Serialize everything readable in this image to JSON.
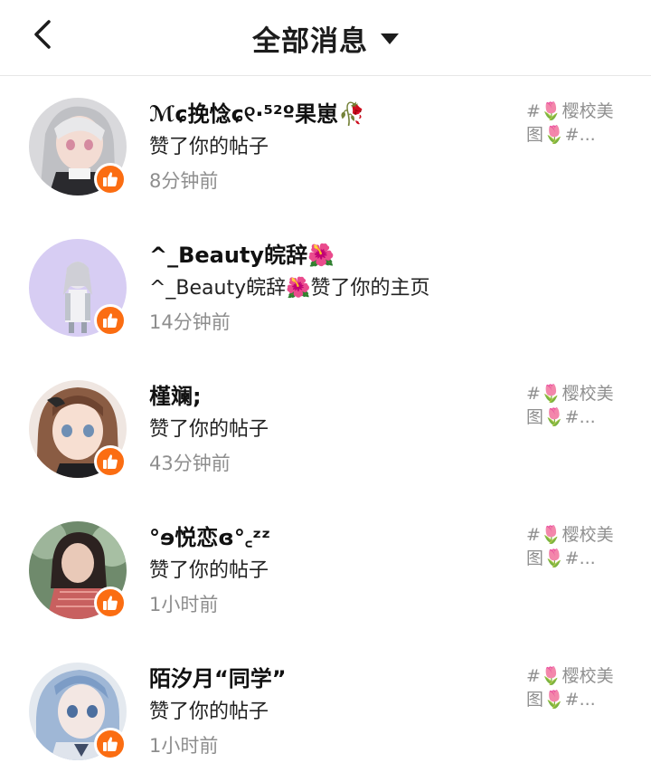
{
  "header": {
    "back_icon": "chevron-left-icon",
    "title": "全部消息",
    "dropdown_icon": "caret-down-icon"
  },
  "colors": {
    "accent": "#fb6d12",
    "text_primary": "#111111",
    "text_secondary": "#8e8e8e",
    "divider": "#e6e6e6"
  },
  "notifications": [
    {
      "name": "ℳɕ挽惗ɕ୧·⁵²º果崽🥀",
      "action": "赞了你的帖子",
      "time": "8分钟前",
      "preview": "#🌷樱校美图🌷#...",
      "badge_icon": "thumbs-up-icon"
    },
    {
      "name": "^_Beauty皖辞🌺",
      "action": "^_Beauty皖辞🌺赞了你的主页",
      "time": "14分钟前",
      "preview": "",
      "badge_icon": "thumbs-up-icon"
    },
    {
      "name": "槿斓;",
      "action": "赞了你的帖子",
      "time": "43分钟前",
      "preview": "#🌷樱校美图🌷#...",
      "badge_icon": "thumbs-up-icon"
    },
    {
      "name": "°ɘ悦恋ɞ°꜀ᶻᶻ",
      "action": "赞了你的帖子",
      "time": "1小时前",
      "preview": "#🌷樱校美图🌷#...",
      "badge_icon": "thumbs-up-icon"
    },
    {
      "name": "陌汐月“同学”",
      "action": "赞了你的帖子",
      "time": "1小时前",
      "preview": "#🌷樱校美图🌷#...",
      "badge_icon": "thumbs-up-icon"
    }
  ]
}
